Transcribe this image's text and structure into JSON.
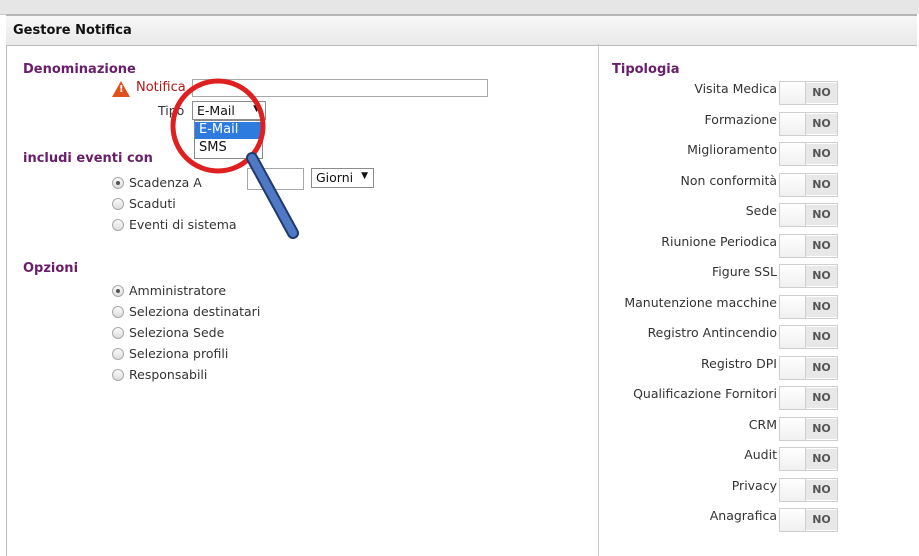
{
  "header": {
    "title": "Gestore Notifica"
  },
  "left": {
    "denominazione_title": "Denominazione",
    "notifica_label": "Notifica",
    "notifica_value": "",
    "tipo_label": "Tipo",
    "tipo_selected": "E-Mail",
    "tipo_options": [
      "E-Mail",
      "SMS"
    ],
    "eventi_title": "includi eventi con",
    "eventi": [
      {
        "label": "Scadenza A",
        "checked": true
      },
      {
        "label": "Scaduti",
        "checked": false
      },
      {
        "label": "Eventi di sistema",
        "checked": false
      }
    ],
    "scadenza_value": "",
    "unit_selected": "Giorni",
    "opzioni_title": "Opzioni",
    "opzioni": [
      {
        "label": "Amministratore",
        "checked": true
      },
      {
        "label": "Seleziona destinatari",
        "checked": false
      },
      {
        "label": "Seleziona Sede",
        "checked": false
      },
      {
        "label": "Seleziona profili",
        "checked": false
      },
      {
        "label": "Responsabili",
        "checked": false
      }
    ]
  },
  "right": {
    "tipologia_title": "Tipologia",
    "toggle_off_label": "NO",
    "items": [
      "Visita Medica",
      "Formazione",
      "Miglioramento",
      "Non conformità",
      "Sede",
      "Riunione Periodica",
      "Figure SSL",
      "Manutenzione macchine",
      "Registro Antincendio",
      "Registro DPI",
      "Qualificazione Fornitori",
      "CRM",
      "Audit",
      "Privacy",
      "Anagrafica"
    ]
  },
  "colors": {
    "section_title": "#6a1d6a",
    "required_label": "#b01818",
    "selected_option": "#2e7be0",
    "annotation": "#e02020"
  }
}
